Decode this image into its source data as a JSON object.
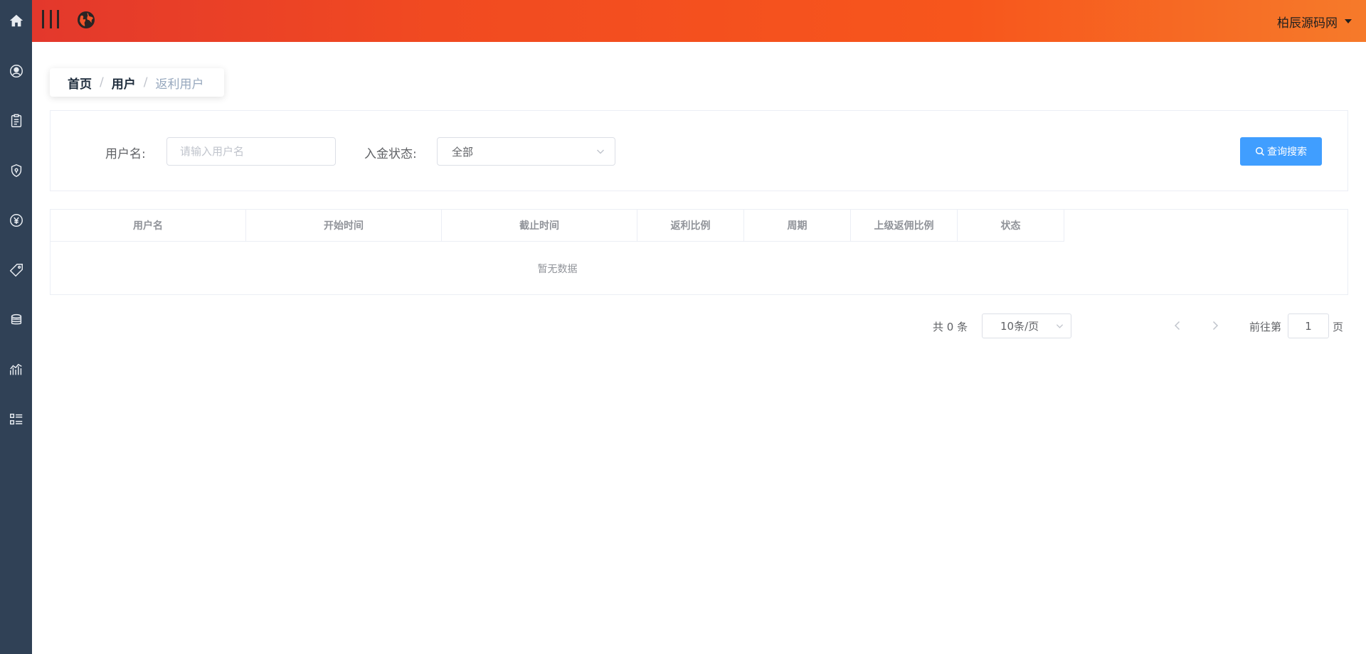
{
  "header": {
    "user_name": "柏辰源码网",
    "accent_gradient": [
      "#e3382c",
      "#f14a21",
      "#f67a2a"
    ]
  },
  "sidebar": {
    "background": "#304156",
    "icons": [
      "home-icon",
      "user-circle-icon",
      "clipboard-icon",
      "shield-icon",
      "yen-icon",
      "tag-icon",
      "coins-icon",
      "chart-icon",
      "list-icon"
    ]
  },
  "breadcrumb": {
    "home": "首页",
    "users": "用户",
    "current": "返利用户",
    "separator": "/"
  },
  "search": {
    "username_label": "用户名:",
    "username_placeholder": "请输入用户名",
    "deposit_status_label": "入金状态:",
    "deposit_status_value": "全部",
    "search_button": "查询搜索"
  },
  "table": {
    "columns": [
      "用户名",
      "开始时间",
      "截止时间",
      "返利比例",
      "周期",
      "上级返佣比例",
      "状态"
    ],
    "rows": [],
    "empty_text": "暂无数据"
  },
  "pagination": {
    "total_text": "共 0 条",
    "page_size": "10条/页",
    "goto_label": "前往第",
    "current_page": "1",
    "page_suffix": "页"
  },
  "colors": {
    "primary": "#409eff",
    "sidebar": "#304156"
  }
}
